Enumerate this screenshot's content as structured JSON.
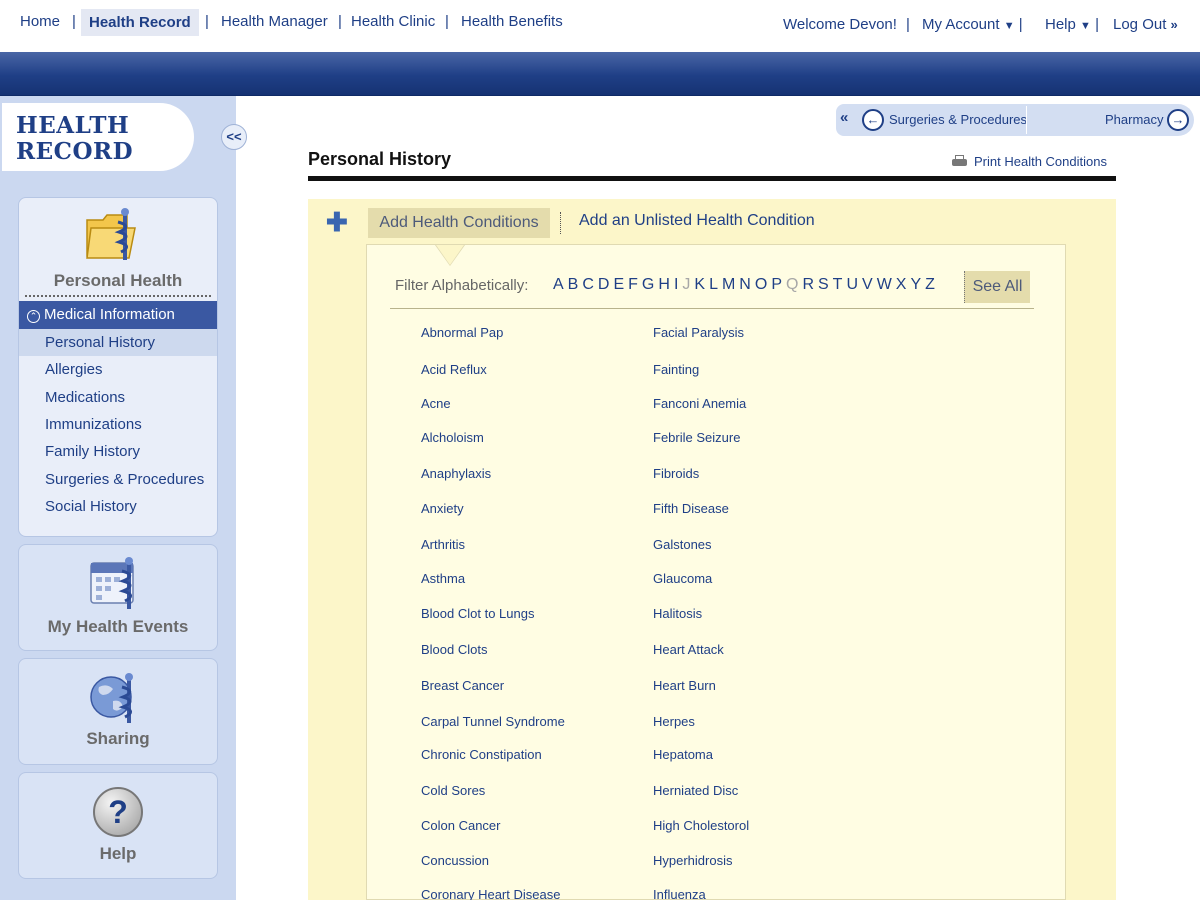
{
  "topnav": {
    "links": [
      "Home",
      "Health Record",
      "Health Manager",
      "Health Clinic",
      "Health Benefits"
    ],
    "welcome": "Welcome Devon!",
    "account": "My Account",
    "help": "Help",
    "logout": "Log Out"
  },
  "sidebar": {
    "logo_line1": "HEALTH",
    "logo_line2": "RECORD",
    "collapse_label": "<<",
    "personal_health": {
      "title": "Personal Health",
      "section": "Medical Information",
      "items": [
        "Personal History",
        "Allergies",
        "Medications",
        "Immunizations",
        "Family History",
        "Surgeries & Procedures",
        "Social History"
      ],
      "selected": "Personal History"
    },
    "panels": [
      "My Health Events",
      "Sharing",
      "Help"
    ]
  },
  "trail": {
    "prev": "Surgeries & Procedures",
    "next": "Pharmacy"
  },
  "main": {
    "title": "Personal History",
    "print": "Print Health Conditions",
    "tab_active": "Add Health Conditions",
    "tab_other": "Add an Unlisted Health Condition",
    "filter_label": "Filter Alphabetically:",
    "letters": [
      "A",
      "B",
      "C",
      "D",
      "E",
      "F",
      "G",
      "H",
      "I",
      "J",
      "K",
      "L",
      "M",
      "N",
      "O",
      "P",
      "Q",
      "R",
      "S",
      "T",
      "U",
      "V",
      "W",
      "X",
      "Y",
      "Z"
    ],
    "disabled_letters": [
      "J",
      "Q"
    ],
    "see_all": "See All",
    "conditions_col1": [
      "Abnormal Pap",
      "Acid Reflux",
      "Acne",
      "Alcholoism",
      "Anaphylaxis",
      "Anxiety",
      "Arthritis",
      "Asthma",
      "Blood Clot to Lungs",
      "Blood Clots",
      "Breast Cancer",
      "Carpal Tunnel Syndrome",
      "Chronic Constipation",
      "Cold Sores",
      "Colon Cancer",
      "Concussion",
      "Coronary Heart Disease"
    ],
    "conditions_col2": [
      "Facial Paralysis",
      "Fainting",
      "Fanconi Anemia",
      "Febrile Seizure",
      "Fibroids",
      "Fifth Disease",
      "Galstones",
      "Glaucoma",
      "Halitosis",
      "Heart Attack",
      "Heart Burn",
      "Herpes",
      "Hepatoma",
      "Herniated Disc",
      "High Cholestorol",
      "Hyperhidrosis",
      "Influenza"
    ]
  },
  "colors": {
    "brand": "#1f3f86",
    "sidebar": "#cbd8f0",
    "highlight": "#fcf6c9"
  }
}
